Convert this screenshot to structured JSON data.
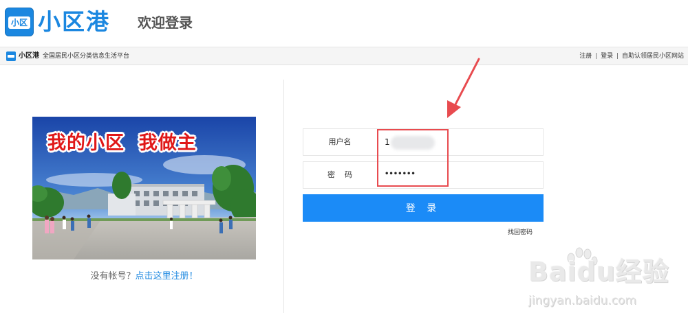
{
  "header": {
    "logo_badge_text": "小区",
    "logo_text": "小区港",
    "welcome": "欢迎登录"
  },
  "subbar": {
    "brand": "小区港",
    "slogan": "全国居民小区分类信息生活平台",
    "links": [
      "注册",
      "登录",
      "自助认领居民小区网站"
    ],
    "separator": "|"
  },
  "banner": {
    "slogan": "我的小区  我做主"
  },
  "register_hint": {
    "prefix": "没有帐号？",
    "link": "点击这里注册！"
  },
  "login_form": {
    "username_label": "用户名",
    "username_value": "1",
    "password_label": "密    码",
    "password_value": "•••••••",
    "submit_label": "登 录",
    "forgot_password": "找回密码"
  },
  "watermark": {
    "brand": "Baidu经验",
    "url": "jingyan.baidu.com"
  },
  "colors": {
    "brand_blue": "#1b87e0",
    "button_blue": "#1b8bf7",
    "annotation_red": "#e84b4f"
  }
}
